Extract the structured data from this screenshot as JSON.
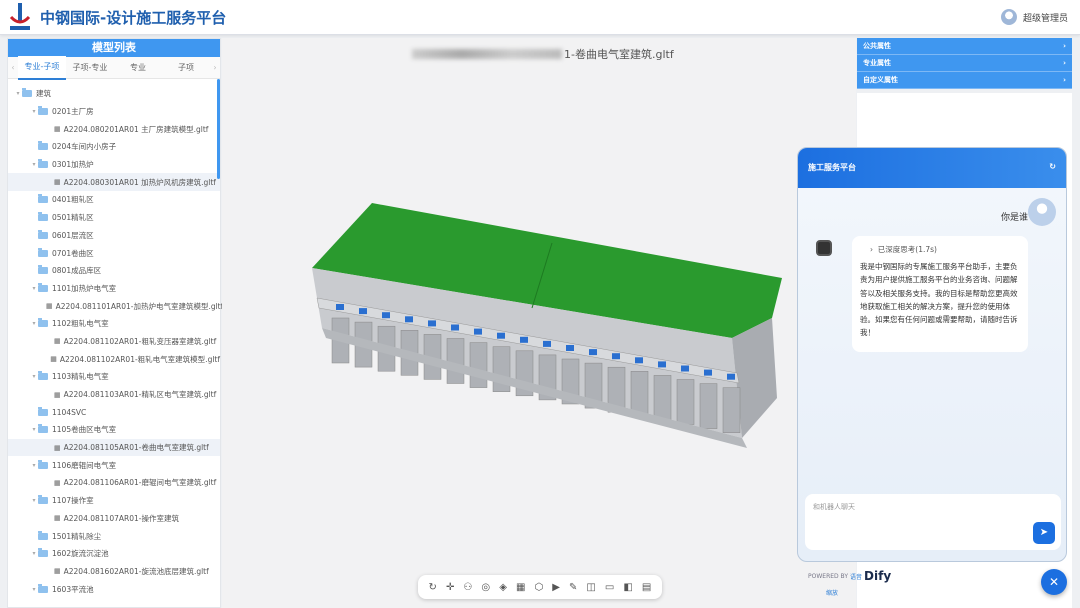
{
  "header": {
    "title": "中钢国际-设计施工服务平台",
    "user": "超级管理员"
  },
  "left_panel": {
    "title": "模型列表",
    "tabs": [
      "专业-子项",
      "子项-专业",
      "专业",
      "子项"
    ],
    "tree": [
      {
        "type": "folder",
        "label": "建筑",
        "level": 0,
        "expanded": true
      },
      {
        "type": "folder",
        "label": "0201主厂房",
        "level": 1,
        "expanded": true
      },
      {
        "type": "file",
        "label": "A2204.080201AR01 主厂房建筑模型.gltf",
        "level": 2
      },
      {
        "type": "folder",
        "label": "0204车间内小房子",
        "level": 1
      },
      {
        "type": "folder",
        "label": "0301加热炉",
        "level": 1,
        "expanded": true
      },
      {
        "type": "file",
        "label": "A2204.080301AR01 加热炉风机房建筑.gltf",
        "level": 2,
        "selected": true
      },
      {
        "type": "folder",
        "label": "0401粗轧区",
        "level": 1
      },
      {
        "type": "folder",
        "label": "0501精轧区",
        "level": 1
      },
      {
        "type": "folder",
        "label": "0601层流区",
        "level": 1
      },
      {
        "type": "folder",
        "label": "0701卷曲区",
        "level": 1
      },
      {
        "type": "folder",
        "label": "0801成品库区",
        "level": 1
      },
      {
        "type": "folder",
        "label": "1101加热炉电气室",
        "level": 1,
        "expanded": true
      },
      {
        "type": "file",
        "label": "A2204.081101AR01-加热炉电气室建筑模型.gltf",
        "level": 2
      },
      {
        "type": "folder",
        "label": "1102粗轧电气室",
        "level": 1,
        "expanded": true
      },
      {
        "type": "file",
        "label": "A2204.081102AR01-粗轧变压器室建筑.gltf",
        "level": 2
      },
      {
        "type": "file",
        "label": "A2204.081102AR01-粗轧电气室建筑模型.gltf",
        "level": 2
      },
      {
        "type": "folder",
        "label": "1103精轧电气室",
        "level": 1,
        "expanded": true
      },
      {
        "type": "file",
        "label": "A2204.081103AR01-精轧区电气室建筑.gltf",
        "level": 2
      },
      {
        "type": "folder",
        "label": "1104SVC",
        "level": 1
      },
      {
        "type": "folder",
        "label": "1105卷曲区电气室",
        "level": 1,
        "expanded": true
      },
      {
        "type": "file",
        "label": "A2204.081105AR01-卷曲电气室建筑.gltf",
        "level": 2,
        "selected": true
      },
      {
        "type": "folder",
        "label": "1106磨辊间电气室",
        "level": 1,
        "expanded": true
      },
      {
        "type": "file",
        "label": "A2204.081106AR01-磨辊间电气室建筑.gltf",
        "level": 2
      },
      {
        "type": "folder",
        "label": "1107操作室",
        "level": 1,
        "expanded": true
      },
      {
        "type": "file",
        "label": "A2204.081107AR01-操作室建筑",
        "level": 2
      },
      {
        "type": "folder",
        "label": "1501精轧除尘",
        "level": 1
      },
      {
        "type": "folder",
        "label": "1602旋流沉淀池",
        "level": 1,
        "expanded": true
      },
      {
        "type": "file",
        "label": "A2204.081602AR01-旋流池底层建筑.gltf",
        "level": 2
      },
      {
        "type": "folder",
        "label": "1603平流池",
        "level": 1,
        "expanded": true
      }
    ]
  },
  "viewer": {
    "title_suffix": "1-卷曲电气室建筑.gltf",
    "tools": [
      "refresh-icon",
      "move-icon",
      "tree-icon",
      "eye-icon",
      "paint-icon",
      "texture-icon",
      "cube-icon",
      "play-icon",
      "clip-icon",
      "section-icon",
      "measure-icon",
      "split-icon",
      "clipboard-icon"
    ],
    "tool_glyphs": [
      "↻",
      "✛",
      "⚇",
      "◎",
      "◈",
      "▦",
      "⬡",
      "▶",
      "✎",
      "◫",
      "▭",
      "◧",
      "▤"
    ]
  },
  "properties": {
    "sections": [
      "公共属性",
      "专业属性",
      "自定义属性"
    ]
  },
  "chat": {
    "title": "施工服务平台",
    "user_message": "你是谁",
    "thinking": "已深度思考(1.7s)",
    "reply": "我是中钢国际的专属施工服务平台助手，主要负责为用户提供施工服务平台的业务咨询、问题解答以及相关服务支持。我的目标是帮助您更高效地获取施工相关的解决方案，提升您的使用体验。如果您有任何问题或需要帮助，请随时告诉我！",
    "input_placeholder": "和机器人聊天",
    "powered_by": "POWERED BY",
    "brand": "Dify",
    "voice_label": "语音",
    "record_label": "缩放"
  }
}
